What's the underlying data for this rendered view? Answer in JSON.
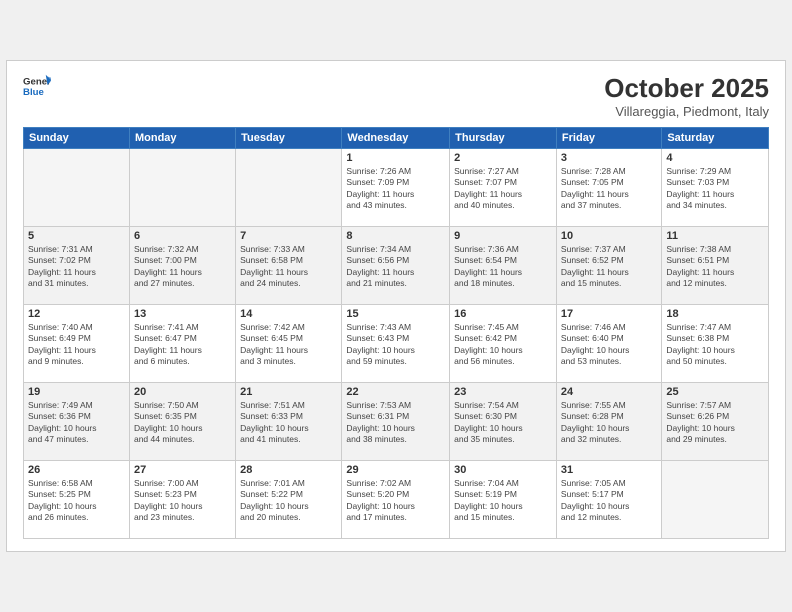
{
  "header": {
    "logo_line1": "General",
    "logo_line2": "Blue",
    "month_title": "October 2025",
    "subtitle": "Villareggia, Piedmont, Italy"
  },
  "weekdays": [
    "Sunday",
    "Monday",
    "Tuesday",
    "Wednesday",
    "Thursday",
    "Friday",
    "Saturday"
  ],
  "weeks": [
    [
      {
        "day": "",
        "info": ""
      },
      {
        "day": "",
        "info": ""
      },
      {
        "day": "",
        "info": ""
      },
      {
        "day": "1",
        "info": "Sunrise: 7:26 AM\nSunset: 7:09 PM\nDaylight: 11 hours\nand 43 minutes."
      },
      {
        "day": "2",
        "info": "Sunrise: 7:27 AM\nSunset: 7:07 PM\nDaylight: 11 hours\nand 40 minutes."
      },
      {
        "day": "3",
        "info": "Sunrise: 7:28 AM\nSunset: 7:05 PM\nDaylight: 11 hours\nand 37 minutes."
      },
      {
        "day": "4",
        "info": "Sunrise: 7:29 AM\nSunset: 7:03 PM\nDaylight: 11 hours\nand 34 minutes."
      }
    ],
    [
      {
        "day": "5",
        "info": "Sunrise: 7:31 AM\nSunset: 7:02 PM\nDaylight: 11 hours\nand 31 minutes."
      },
      {
        "day": "6",
        "info": "Sunrise: 7:32 AM\nSunset: 7:00 PM\nDaylight: 11 hours\nand 27 minutes."
      },
      {
        "day": "7",
        "info": "Sunrise: 7:33 AM\nSunset: 6:58 PM\nDaylight: 11 hours\nand 24 minutes."
      },
      {
        "day": "8",
        "info": "Sunrise: 7:34 AM\nSunset: 6:56 PM\nDaylight: 11 hours\nand 21 minutes."
      },
      {
        "day": "9",
        "info": "Sunrise: 7:36 AM\nSunset: 6:54 PM\nDaylight: 11 hours\nand 18 minutes."
      },
      {
        "day": "10",
        "info": "Sunrise: 7:37 AM\nSunset: 6:52 PM\nDaylight: 11 hours\nand 15 minutes."
      },
      {
        "day": "11",
        "info": "Sunrise: 7:38 AM\nSunset: 6:51 PM\nDaylight: 11 hours\nand 12 minutes."
      }
    ],
    [
      {
        "day": "12",
        "info": "Sunrise: 7:40 AM\nSunset: 6:49 PM\nDaylight: 11 hours\nand 9 minutes."
      },
      {
        "day": "13",
        "info": "Sunrise: 7:41 AM\nSunset: 6:47 PM\nDaylight: 11 hours\nand 6 minutes."
      },
      {
        "day": "14",
        "info": "Sunrise: 7:42 AM\nSunset: 6:45 PM\nDaylight: 11 hours\nand 3 minutes."
      },
      {
        "day": "15",
        "info": "Sunrise: 7:43 AM\nSunset: 6:43 PM\nDaylight: 10 hours\nand 59 minutes."
      },
      {
        "day": "16",
        "info": "Sunrise: 7:45 AM\nSunset: 6:42 PM\nDaylight: 10 hours\nand 56 minutes."
      },
      {
        "day": "17",
        "info": "Sunrise: 7:46 AM\nSunset: 6:40 PM\nDaylight: 10 hours\nand 53 minutes."
      },
      {
        "day": "18",
        "info": "Sunrise: 7:47 AM\nSunset: 6:38 PM\nDaylight: 10 hours\nand 50 minutes."
      }
    ],
    [
      {
        "day": "19",
        "info": "Sunrise: 7:49 AM\nSunset: 6:36 PM\nDaylight: 10 hours\nand 47 minutes."
      },
      {
        "day": "20",
        "info": "Sunrise: 7:50 AM\nSunset: 6:35 PM\nDaylight: 10 hours\nand 44 minutes."
      },
      {
        "day": "21",
        "info": "Sunrise: 7:51 AM\nSunset: 6:33 PM\nDaylight: 10 hours\nand 41 minutes."
      },
      {
        "day": "22",
        "info": "Sunrise: 7:53 AM\nSunset: 6:31 PM\nDaylight: 10 hours\nand 38 minutes."
      },
      {
        "day": "23",
        "info": "Sunrise: 7:54 AM\nSunset: 6:30 PM\nDaylight: 10 hours\nand 35 minutes."
      },
      {
        "day": "24",
        "info": "Sunrise: 7:55 AM\nSunset: 6:28 PM\nDaylight: 10 hours\nand 32 minutes."
      },
      {
        "day": "25",
        "info": "Sunrise: 7:57 AM\nSunset: 6:26 PM\nDaylight: 10 hours\nand 29 minutes."
      }
    ],
    [
      {
        "day": "26",
        "info": "Sunrise: 6:58 AM\nSunset: 5:25 PM\nDaylight: 10 hours\nand 26 minutes."
      },
      {
        "day": "27",
        "info": "Sunrise: 7:00 AM\nSunset: 5:23 PM\nDaylight: 10 hours\nand 23 minutes."
      },
      {
        "day": "28",
        "info": "Sunrise: 7:01 AM\nSunset: 5:22 PM\nDaylight: 10 hours\nand 20 minutes."
      },
      {
        "day": "29",
        "info": "Sunrise: 7:02 AM\nSunset: 5:20 PM\nDaylight: 10 hours\nand 17 minutes."
      },
      {
        "day": "30",
        "info": "Sunrise: 7:04 AM\nSunset: 5:19 PM\nDaylight: 10 hours\nand 15 minutes."
      },
      {
        "day": "31",
        "info": "Sunrise: 7:05 AM\nSunset: 5:17 PM\nDaylight: 10 hours\nand 12 minutes."
      },
      {
        "day": "",
        "info": ""
      }
    ]
  ]
}
